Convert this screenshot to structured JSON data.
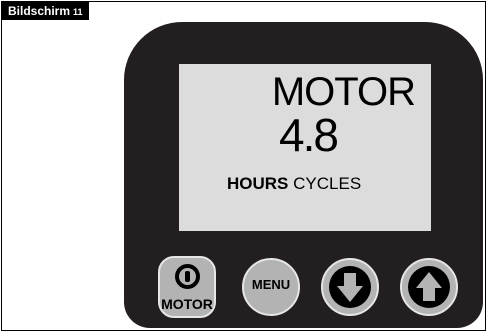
{
  "tag": {
    "label": "Bildschirm",
    "number": "11"
  },
  "display": {
    "mode": "MOTOR",
    "value": "4.8",
    "unit_selected": "HOURS",
    "unit_other": "CYCLES"
  },
  "buttons": {
    "motor_label": "MOTOR",
    "menu_label": "MENU",
    "down_icon": "arrow-down-icon",
    "up_icon": "arrow-up-icon",
    "power_icon": "power-icon"
  },
  "colors": {
    "panel": "#231f20",
    "screen": "#dcdcdc",
    "button": "#b3b3b3"
  }
}
